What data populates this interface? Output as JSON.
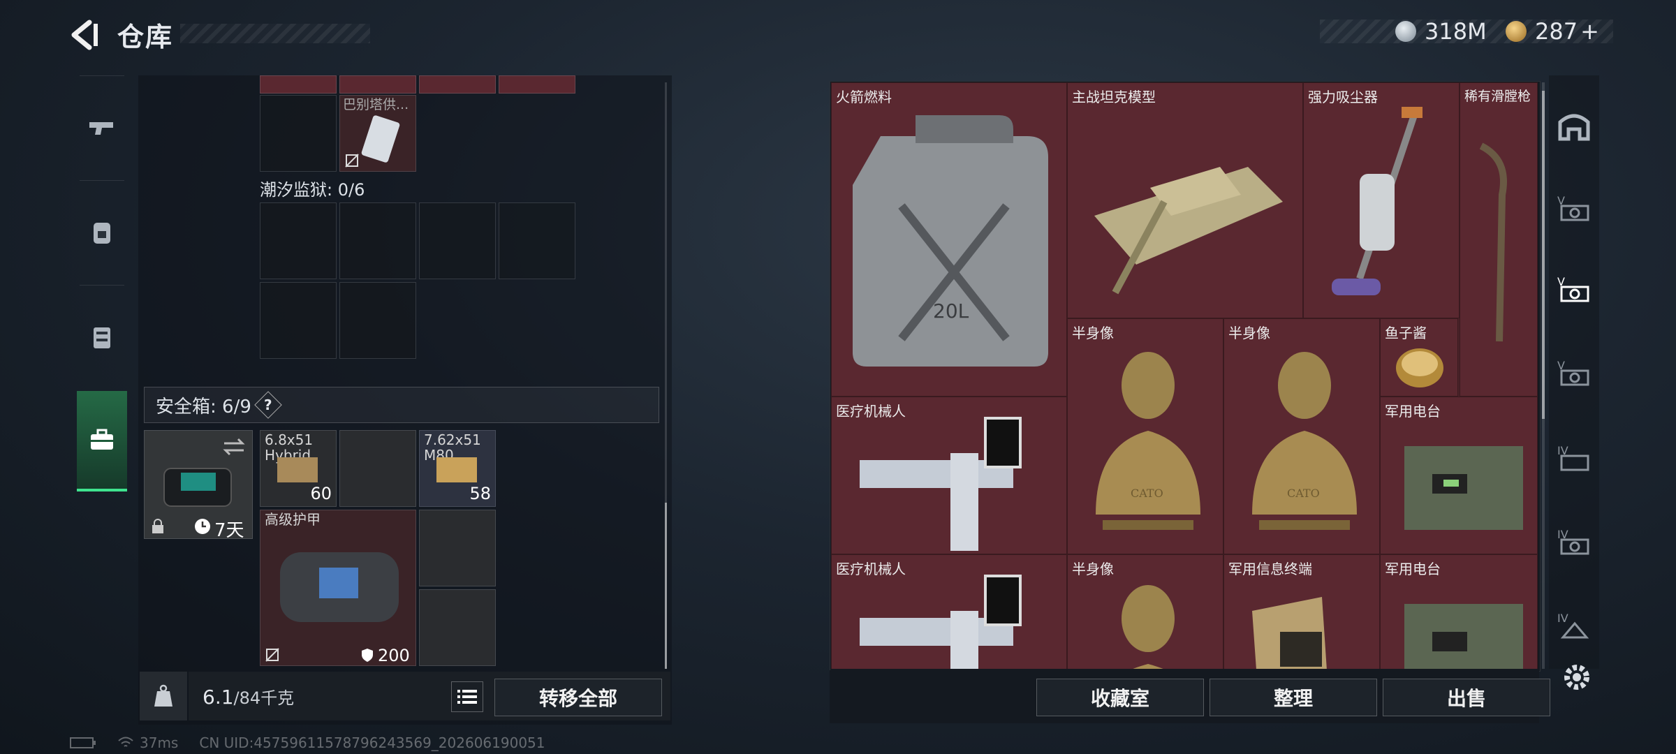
{
  "header": {
    "title": "仓库",
    "currency": [
      {
        "icon": "silver-coin-icon",
        "value": "318M",
        "color": "#b8c2cc"
      },
      {
        "icon": "gold-coin-icon",
        "value": "287",
        "suffix": "+",
        "color": "#d2a64a"
      }
    ]
  },
  "left_rail": {
    "items": [
      {
        "icon": "pistol-icon"
      },
      {
        "icon": "backpack-icon"
      },
      {
        "icon": "chest-rig-icon"
      },
      {
        "icon": "briefcase-icon",
        "active": true
      }
    ]
  },
  "left_panel": {
    "top_item_label": "巴别塔供...",
    "tidal_prison_label": "潮汐监狱: 0/6",
    "safe_box_label": "安全箱: 6/9",
    "safe_box_help": "?",
    "safe_box_timer": "7天",
    "items": [
      {
        "name": "6.8x51\nHybrid",
        "count": "60"
      },
      {
        "name": "7.62x51\nM80",
        "count": "58"
      },
      {
        "name": "高级护甲",
        "durability": "200"
      }
    ]
  },
  "footer_left": {
    "weight_current": "6.1",
    "weight_max": "/84千克",
    "transfer_all": "转移全部"
  },
  "right_grid": {
    "items": [
      {
        "name": "火箭燃料"
      },
      {
        "name": "主战坦克模型"
      },
      {
        "name": "强力吸尘器"
      },
      {
        "name": "稀有滑膛枪"
      },
      {
        "name": "半身像"
      },
      {
        "name": "半身像"
      },
      {
        "name": "鱼子酱"
      },
      {
        "name": "医疗机械人"
      },
      {
        "name": "军用电台"
      },
      {
        "name": "医疗机械人"
      },
      {
        "name": "半身像"
      },
      {
        "name": "军用信息终端"
      },
      {
        "name": "军用电台"
      }
    ],
    "fuel_can_label": "20L",
    "bust_engraving": "CATO"
  },
  "footer_right": {
    "collection_room": "收藏室",
    "organize": "整理",
    "sell": "出售"
  },
  "right_rail": {
    "items": [
      {
        "icon": "home-arch-icon"
      },
      {
        "icon": "tier-v-item-icon",
        "label": "V"
      },
      {
        "icon": "tier-v-item-icon",
        "label": "V",
        "active": true
      },
      {
        "icon": "tier-v-item-icon",
        "label": "V"
      },
      {
        "icon": "tier-iv-item-icon",
        "label": "IV"
      },
      {
        "icon": "tier-iv-item-icon",
        "label": "IV"
      },
      {
        "icon": "tier-iv-item-icon",
        "label": "IV"
      }
    ],
    "settings_icon": "gear-icon"
  },
  "status": {
    "ping": "37ms",
    "uid": "CN UID:45759611578796243569_202606190051"
  }
}
